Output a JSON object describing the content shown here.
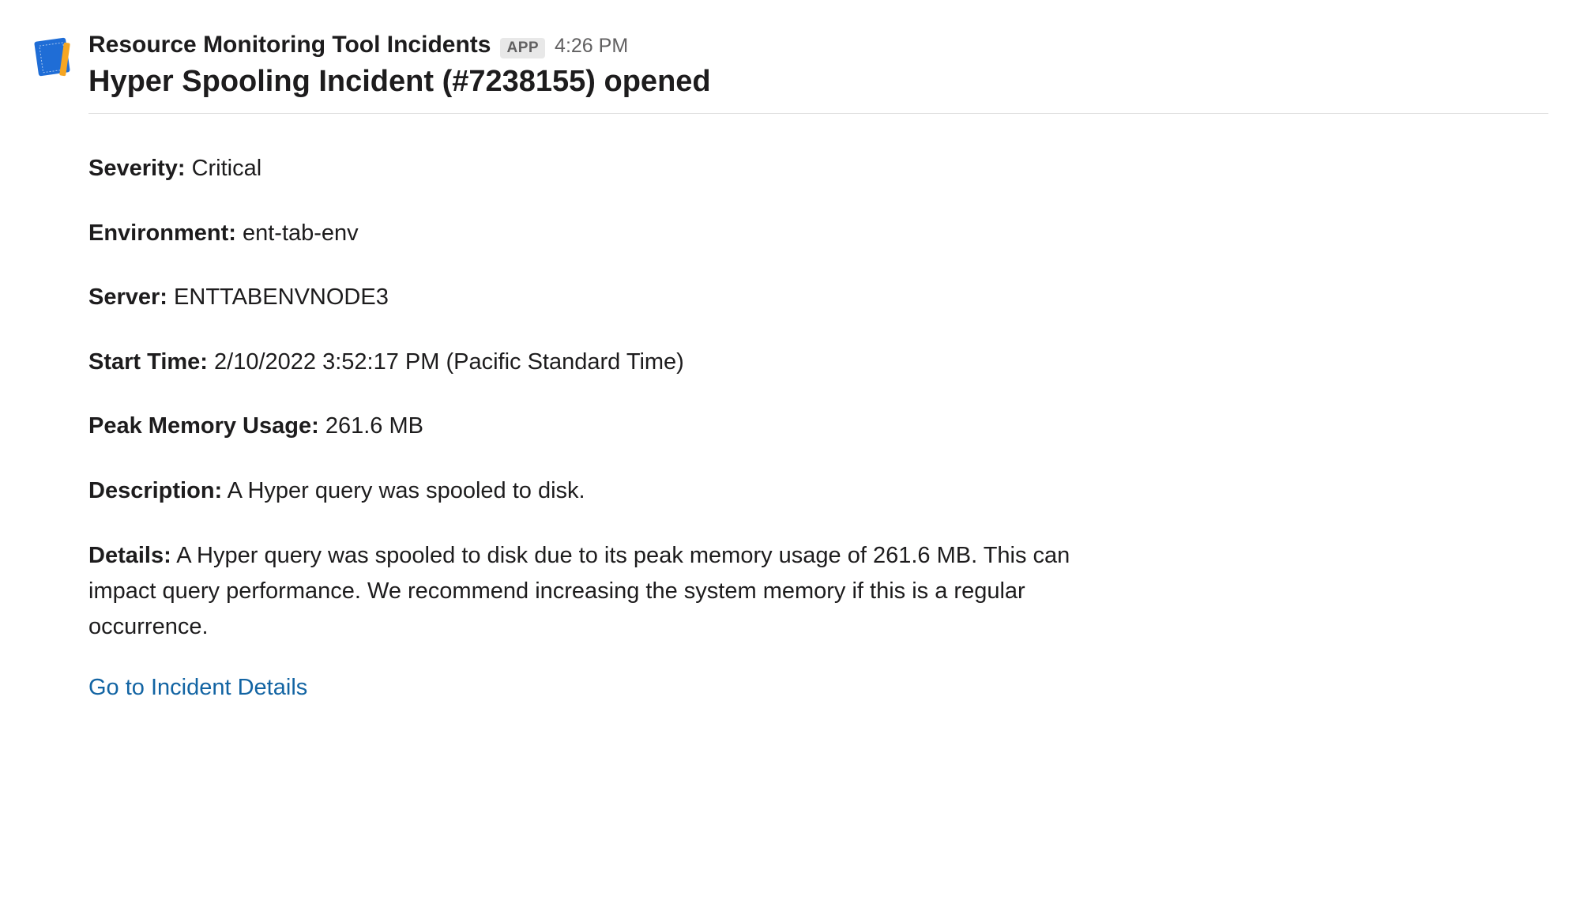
{
  "header": {
    "app_name": "Resource Monitoring Tool Incidents",
    "app_badge": "APP",
    "timestamp": "4:26 PM"
  },
  "title": "Hyper Spooling Incident (#7238155) opened",
  "fields": {
    "severity": {
      "label": "Severity:",
      "value": "Critical"
    },
    "environment": {
      "label": "Environment:",
      "value": "ent-tab-env"
    },
    "server": {
      "label": "Server:",
      "value": "ENTTABENVNODE3"
    },
    "start_time": {
      "label": "Start Time:",
      "value": "2/10/2022 3:52:17 PM (Pacific Standard Time)"
    },
    "peak_memory": {
      "label": "Peak Memory Usage:",
      "value": "261.6 MB"
    },
    "description": {
      "label": "Description:",
      "value": "A Hyper query was spooled to disk."
    },
    "details": {
      "label": "Details:",
      "value": "A Hyper query was spooled to disk due to its peak memory usage of 261.6 MB. This can impact query performance. We recommend increasing the system memory if this is a regular occurrence."
    }
  },
  "link": {
    "label": "Go to Incident Details"
  }
}
